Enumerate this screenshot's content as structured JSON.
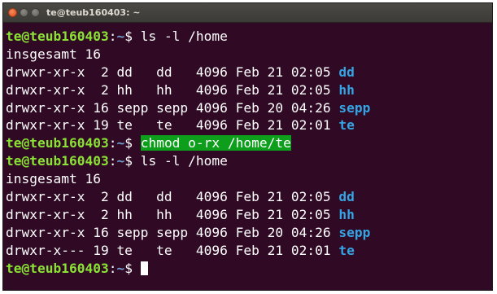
{
  "window": {
    "title": "te@teub160403: ~"
  },
  "prompt": {
    "user_host": "te@teub160403",
    "separator": ":",
    "path": "~",
    "symbol": "$ "
  },
  "lines": [
    {
      "type": "prompt",
      "command": "ls -l /home"
    },
    {
      "type": "text",
      "text": "insgesamt 16"
    },
    {
      "type": "entry",
      "prefix": "drwxr-xr-x  2 dd   dd   4096 Feb 21 02:05 ",
      "name": "dd"
    },
    {
      "type": "entry",
      "prefix": "drwxr-xr-x  2 hh   hh   4096 Feb 21 02:05 ",
      "name": "hh"
    },
    {
      "type": "entry",
      "prefix": "drwxr-xr-x 16 sepp sepp 4096 Feb 20 04:26 ",
      "name": "sepp"
    },
    {
      "type": "entry",
      "prefix": "drwxr-xr-x 19 te   te   4096 Feb 21 02:01 ",
      "name": "te"
    },
    {
      "type": "prompt-highlight",
      "command": "chmod o-rx /home/te"
    },
    {
      "type": "prompt",
      "command": "ls -l /home"
    },
    {
      "type": "text",
      "text": "insgesamt 16"
    },
    {
      "type": "entry",
      "prefix": "drwxr-xr-x  2 dd   dd   4096 Feb 21 02:05 ",
      "name": "dd"
    },
    {
      "type": "entry",
      "prefix": "drwxr-xr-x  2 hh   hh   4096 Feb 21 02:05 ",
      "name": "hh"
    },
    {
      "type": "entry",
      "prefix": "drwxr-xr-x 16 sepp sepp 4096 Feb 20 04:26 ",
      "name": "sepp"
    },
    {
      "type": "entry",
      "prefix": "drwxr-x--- 19 te   te   4096 Feb 21 02:01 ",
      "name": "te"
    },
    {
      "type": "prompt-cursor",
      "command": ""
    }
  ],
  "colors": {
    "background": "#300a24",
    "prompt_user": "#8ae234",
    "prompt_path": "#729fcf",
    "directory": "#34a4e4",
    "highlight": "#0d9e1c"
  },
  "icons": {
    "close": "close-icon",
    "minimize": "minimize-icon",
    "maximize": "maximize-icon"
  }
}
